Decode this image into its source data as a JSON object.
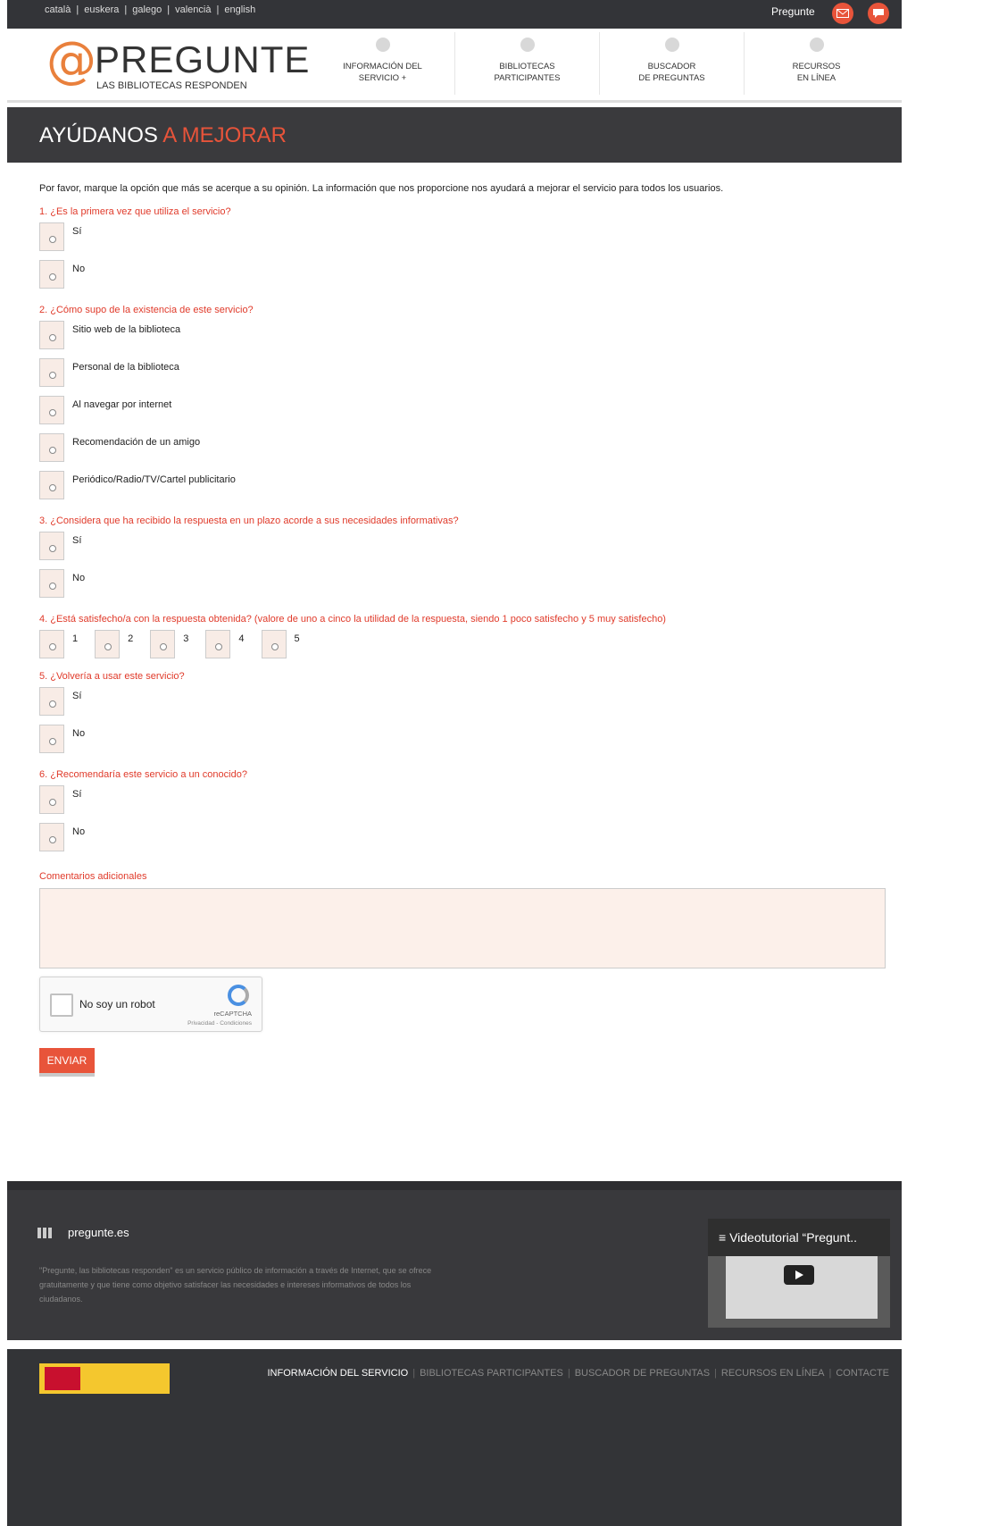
{
  "top": {
    "languages": [
      "català",
      "euskera",
      "galego",
      "valencià",
      "english"
    ],
    "user_label": "Pregunte",
    "icons": [
      "email-icon",
      "chat-icon"
    ]
  },
  "header": {
    "brand": "PREGUNTE",
    "tagline": "LAS BIBLIOTECAS RESPONDEN",
    "nav": [
      {
        "label": "INFORMACIÓN DEL\nSERVICIO +",
        "icon": "info-icon"
      },
      {
        "label": "BIBLIOTECAS\nPARTICIPANTES",
        "icon": "people-icon"
      },
      {
        "label": "BUSCADOR\nDE PREGUNTAS",
        "icon": "search-icon"
      },
      {
        "label": "RECURSOS\nEN LÍNEA",
        "icon": "globe-icon"
      }
    ]
  },
  "banner": {
    "title_part1": "AYÚDANOS",
    "title_part2": "A MEJORAR"
  },
  "form": {
    "intro": "Por favor, marque la opción que más se acerque a su opinión. La información que nos proporcione nos ayudará a mejorar el servicio para todos los usuarios.",
    "q1": {
      "question": "1. ¿Es la primera vez que utiliza el servicio?",
      "options": [
        "Sí",
        "No"
      ]
    },
    "q2": {
      "question": "2. ¿Cómo supo de la existencia de este servicio?",
      "options": [
        "Sitio web de la biblioteca",
        "Personal de la biblioteca",
        "Al navegar por internet",
        "Recomendación de un amigo",
        "Periódico/Radio/TV/Cartel publicitario"
      ]
    },
    "q3": {
      "question": "3. ¿Considera que ha recibido la respuesta en un plazo acorde a sus necesidades informativas?",
      "options": [
        "Sí",
        "No"
      ]
    },
    "q4": {
      "question": "4. ¿Está satisfecho/a con la respuesta obtenida? (valore de uno a cinco la utilidad de la respuesta, siendo 1 poco satisfecho y 5 muy satisfecho)",
      "options": [
        "1",
        "2",
        "3",
        "4",
        "5"
      ]
    },
    "q5": {
      "question": "5. ¿Volvería a usar este servicio?",
      "options": [
        "Sí",
        "No"
      ]
    },
    "q6": {
      "question": "6. ¿Recomendaría este servicio a un conocido?",
      "options": [
        "Sí",
        "No"
      ]
    },
    "comments_label": "Comentarios adicionales",
    "comments_value": "",
    "captcha": {
      "label": "No soy un robot",
      "brand": "reCAPTCHA",
      "links": "Privacidad - Condiciones"
    },
    "submit_label": "ENVIAR"
  },
  "footer": {
    "site": "pregunte.es",
    "description": "\"Pregunte, las bibliotecas responden\" es un servicio público de información a través de Internet, que se ofrece gratuitamente y que tiene como objetivo satisfacer las necesidades e intereses informativos de todos los ciudadanos.",
    "video_title": "Videotutorial “Pregunt.."
  },
  "bottom": {
    "links": [
      "INFORMACIÓN DEL SERVICIO",
      "BIBLIOTECAS PARTICIPANTES",
      "BUSCADOR DE PREGUNTAS",
      "RECURSOS EN LÍNEA",
      "CONTACTE"
    ]
  },
  "colors": {
    "accent": "#e8543a",
    "dark": "#3a3a3d",
    "question": "#e03a2a",
    "logo_orange": "#e9803c"
  }
}
